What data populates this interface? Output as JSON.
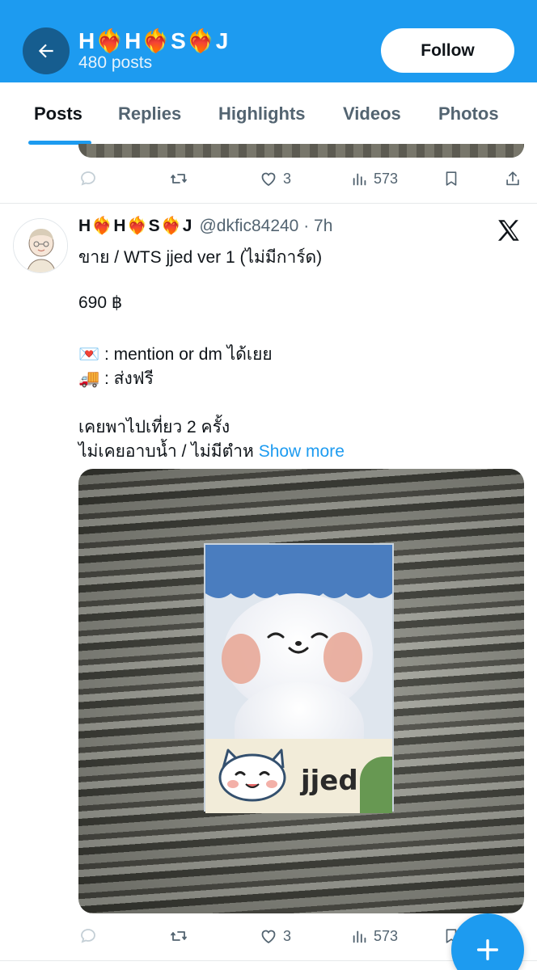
{
  "header": {
    "profile_name": "H❤️‍🔥H❤️‍🔥S❤️‍🔥J",
    "post_count": "480 posts",
    "follow_label": "Follow",
    "back_icon": "arrow-left-icon"
  },
  "tabs": [
    {
      "label": "Posts",
      "active": true
    },
    {
      "label": "Replies",
      "active": false
    },
    {
      "label": "Highlights",
      "active": false
    },
    {
      "label": "Videos",
      "active": false
    },
    {
      "label": "Photos",
      "active": false
    }
  ],
  "prev_tweet": {
    "actions": {
      "reply": "",
      "retweet": "",
      "like": "3",
      "views": "573"
    }
  },
  "tweet": {
    "author_name": "H❤️‍🔥H❤️‍🔥S❤️‍🔥J",
    "handle_time": "@dkfic84240 · 7h",
    "lines": [
      "ขาย / WTS  jjed ver 1 (ไม่มีการ์ด)",
      "690 ฿",
      "💌 : mention or dm ได้เยย",
      "🚚 : ส่งฟรี",
      "เคยพาไปเที่ยว 2 ครั้ง",
      "ไม่เคยอาบน้ำ / ไม่มีตำห"
    ],
    "show_more": "Show more",
    "photo_text": "jjed",
    "actions": {
      "reply": "",
      "retweet": "",
      "like": "3",
      "views": "573"
    }
  },
  "colors": {
    "accent": "#1d9bf0",
    "back_button": "#165d8f",
    "secondary_text": "#536471"
  }
}
